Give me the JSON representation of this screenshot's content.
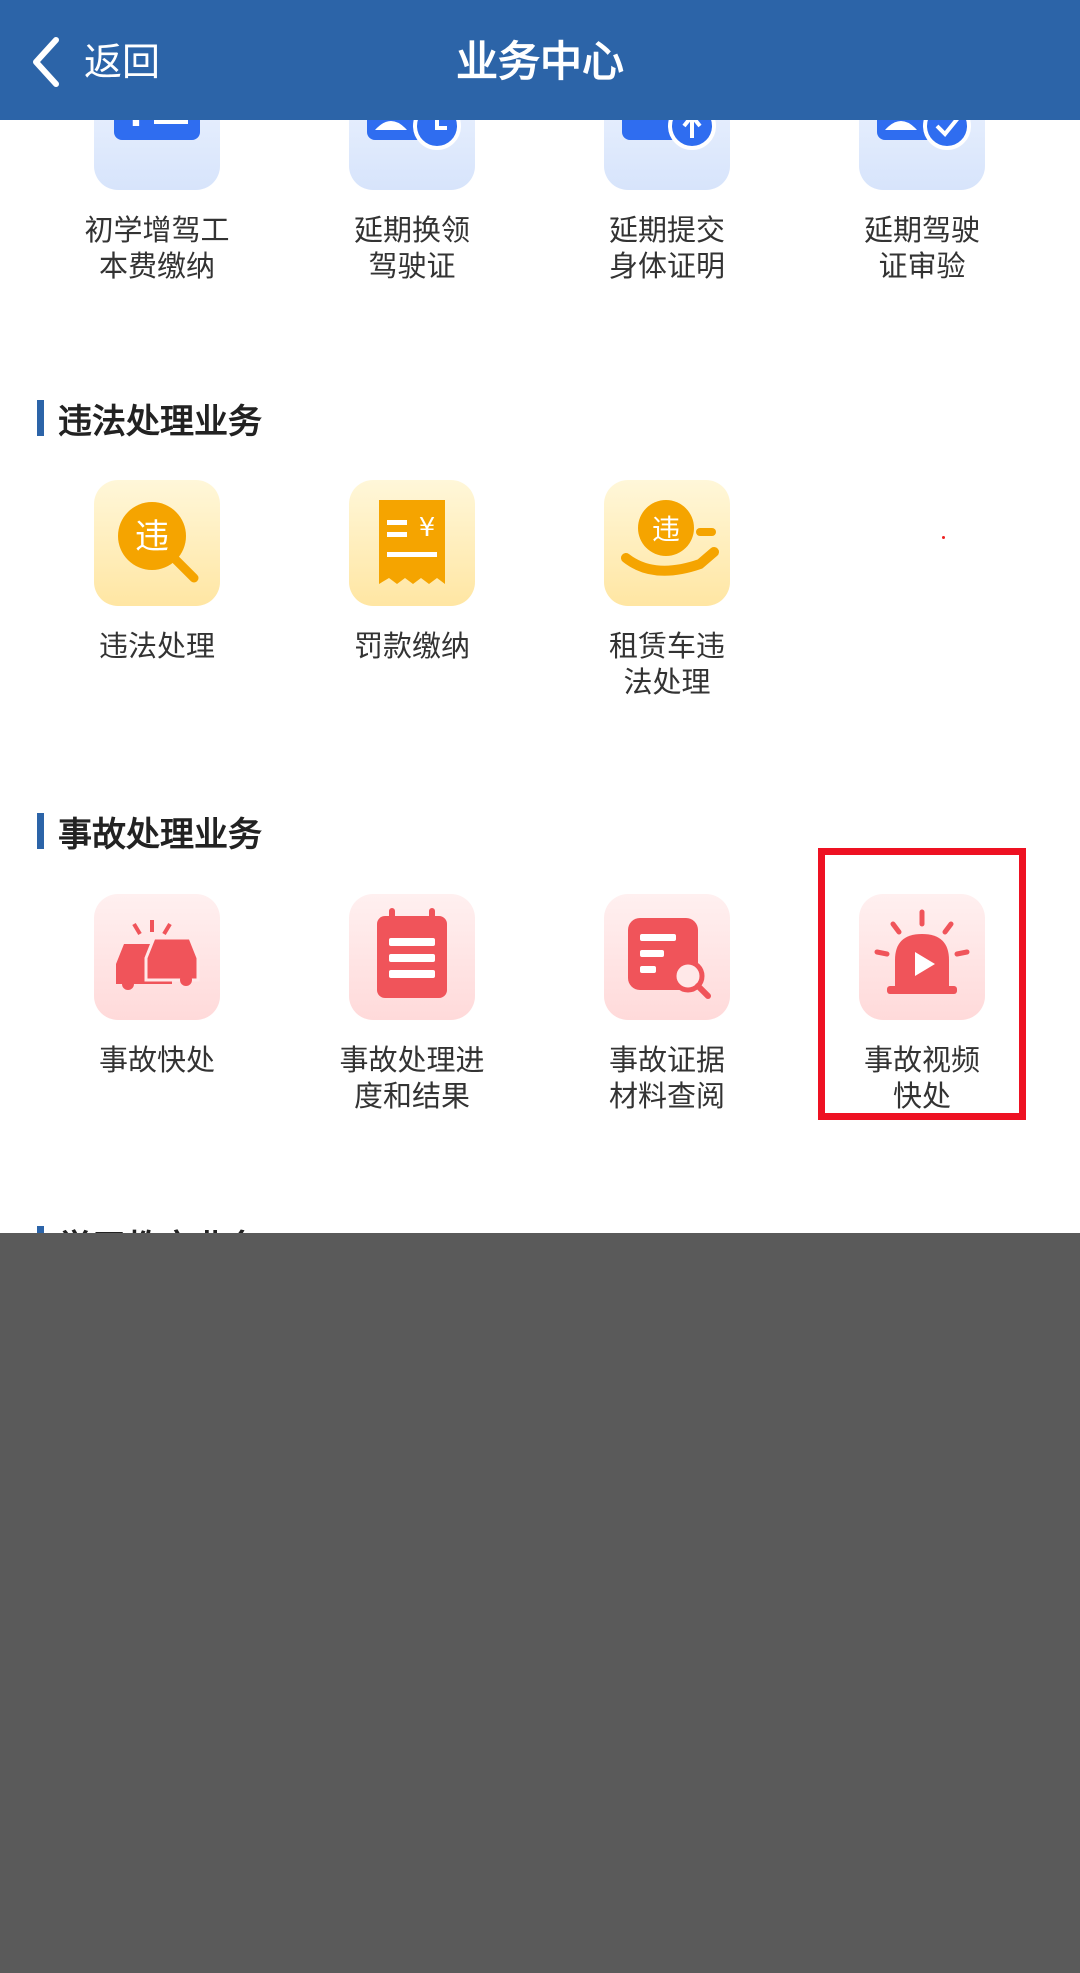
{
  "header": {
    "back_label": "返回",
    "title": "业务中心",
    "bg_color": "#2c64a8"
  },
  "sections": {
    "license": {
      "items": [
        {
          "label": "初学增驾工\n本费缴纳",
          "icon": "id-card-yen-icon"
        },
        {
          "label": "延期换领\n驾驶证",
          "icon": "license-clock-icon"
        },
        {
          "label": "延期提交\n身体证明",
          "icon": "medical-upload-icon"
        },
        {
          "label": "延期驾驶\n证审验",
          "icon": "license-check-icon"
        }
      ]
    },
    "violation": {
      "title": "违法处理业务",
      "items": [
        {
          "label": "违法处理",
          "icon": "violation-search-icon"
        },
        {
          "label": "罚款缴纳",
          "icon": "fine-receipt-icon"
        },
        {
          "label": "租赁车违\n法处理",
          "icon": "rental-violation-icon"
        }
      ]
    },
    "accident": {
      "title": "事故处理业务",
      "items": [
        {
          "label": "事故快处",
          "icon": "car-crash-icon"
        },
        {
          "label": "事故处理进\n度和结果",
          "icon": "calendar-list-icon"
        },
        {
          "label": "事故证据\n材料查阅",
          "icon": "document-search-icon"
        },
        {
          "label": "事故视频\n快处",
          "icon": "siren-video-icon"
        }
      ]
    },
    "education": {
      "title": "学习教育业务"
    }
  },
  "colors": {
    "accent_blue": "#2c64a8",
    "icon_blue": "#2f6df0",
    "icon_orange": "#f5a400",
    "icon_red": "#f0545a",
    "highlight_red": "#ee1122"
  }
}
